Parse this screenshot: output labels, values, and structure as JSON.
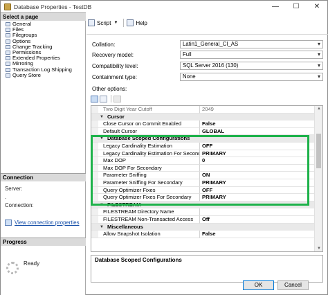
{
  "window": {
    "title": "Database Properties - TestDB",
    "minimize": "—",
    "maximize": "☐",
    "close": "✕"
  },
  "left": {
    "select_page_header": "Select a page",
    "pages": [
      "General",
      "Files",
      "Filegroups",
      "Options",
      "Change Tracking",
      "Permissions",
      "Extended Properties",
      "Mirroring",
      "Transaction Log Shipping",
      "Query Store"
    ],
    "connection_header": "Connection",
    "server_label": "Server:",
    "server_value": ".",
    "connection_label": "Connection:",
    "view_connection_link": "View connection properties",
    "progress_header": "Progress",
    "progress_status": "Ready"
  },
  "toolbar": {
    "script_label": "Script",
    "help_label": "Help"
  },
  "fields": {
    "collation": {
      "label": "Collation:",
      "value": "Latin1_General_CI_AS"
    },
    "recovery_model": {
      "label": "Recovery model:",
      "value": "Full"
    },
    "compatibility_level": {
      "label": "Compatibility level:",
      "value": "SQL Server 2016 (130)"
    },
    "containment_type": {
      "label": "Containment type:",
      "value": "None"
    }
  },
  "other_options_label": "Other options:",
  "grid": {
    "rows": [
      {
        "kind": "prop",
        "name": "Two Digit Year Cutoff",
        "value": "2049",
        "dim": true
      },
      {
        "kind": "cat",
        "name": "Cursor"
      },
      {
        "kind": "prop",
        "name": "Close Cursor on Commit Enabled",
        "value": "False"
      },
      {
        "kind": "prop",
        "name": "Default Cursor",
        "value": "GLOBAL"
      },
      {
        "kind": "cat",
        "name": "Database Scoped Configurations"
      },
      {
        "kind": "prop",
        "name": "Legacy Cardinality Estimation",
        "value": "OFF"
      },
      {
        "kind": "prop",
        "name": "Legacy Cardinality Estimation For Secondary",
        "value": "PRIMARY"
      },
      {
        "kind": "prop",
        "name": "Max DOP",
        "value": "0"
      },
      {
        "kind": "prop",
        "name": "Max DOP For Secondary",
        "value": ""
      },
      {
        "kind": "prop",
        "name": "Parameter Sniffing",
        "value": "ON"
      },
      {
        "kind": "prop",
        "name": "Parameter Sniffing For Secondary",
        "value": "PRIMARY"
      },
      {
        "kind": "prop",
        "name": "Query Optimizer Fixes",
        "value": "OFF"
      },
      {
        "kind": "prop",
        "name": "Query Optimizer Fixes For Secondary",
        "value": "PRIMARY"
      },
      {
        "kind": "cat",
        "name": "FILESTREAM"
      },
      {
        "kind": "prop",
        "name": "FILESTREAM Directory Name",
        "value": ""
      },
      {
        "kind": "prop",
        "name": "FILESTREAM Non-Transacted Access",
        "value": "Off"
      },
      {
        "kind": "cat",
        "name": "Miscellaneous"
      },
      {
        "kind": "prop",
        "name": "Allow Snapshot Isolation",
        "value": "False"
      }
    ]
  },
  "description": {
    "title": "Database Scoped Configurations"
  },
  "buttons": {
    "ok": "OK",
    "cancel": "Cancel"
  },
  "colors": {
    "highlight": "#1db24a",
    "link": "#0f4aa6",
    "ok_border": "#0078d7"
  }
}
